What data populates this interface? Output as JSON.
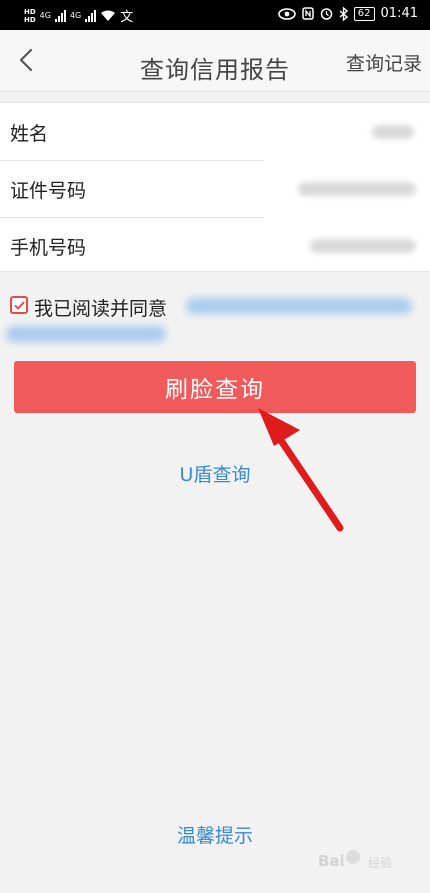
{
  "status_bar": {
    "left_hd_top": "HD",
    "left_hd_bottom": "HD",
    "net1": "4G",
    "net2": "4G",
    "battery": "62",
    "time": "01:41"
  },
  "header": {
    "title": "查询信用报告",
    "records_label": "查询记录"
  },
  "form": {
    "rows": [
      {
        "label": "姓名"
      },
      {
        "label": "证件号码"
      },
      {
        "label": "手机号码"
      }
    ]
  },
  "agreement": {
    "checked": true,
    "text": "我已阅读并同意"
  },
  "buttons": {
    "face_query": "刷脸查询",
    "ukey_query": "U盾查询",
    "tips": "温馨提示"
  },
  "watermark": {
    "brand": "Bai",
    "sub": "经验"
  },
  "colors": {
    "primary_button": "#f05a5a",
    "link": "#3a8ad0",
    "annotation_arrow": "#e01b1b"
  }
}
